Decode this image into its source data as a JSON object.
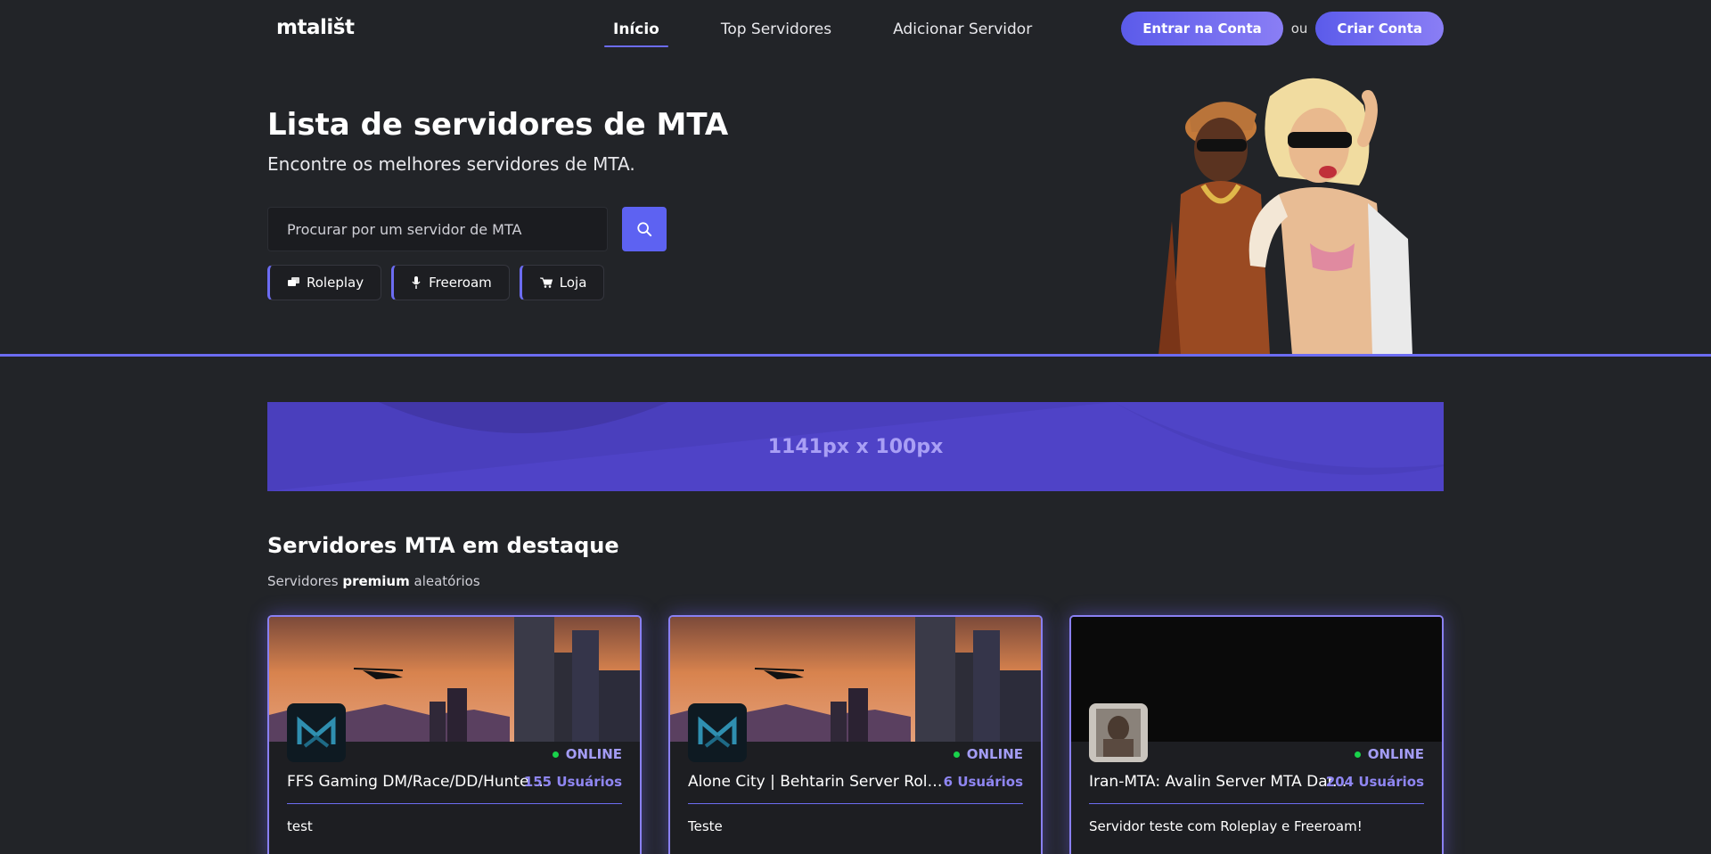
{
  "nav": {
    "logo": "mtališt",
    "links": [
      "Início",
      "Top Servidores",
      "Adicionar Servidor"
    ],
    "login": "Entrar na Conta",
    "or": "ou",
    "signup": "Criar Conta"
  },
  "hero": {
    "title": "Lista de servidores de MTA",
    "subtitle": "Encontre os melhores servidores de MTA.",
    "search_placeholder": "Procurar por um servidor de MTA",
    "tags": [
      {
        "label": "Roleplay",
        "icon": "chat-icon"
      },
      {
        "label": "Freeroam",
        "icon": "microphone-icon"
      },
      {
        "label": "Loja",
        "icon": "cart-icon"
      }
    ]
  },
  "banner": {
    "text": "1141px x 100px"
  },
  "featured": {
    "title": "Servidores MTA em destaque",
    "subtitle_pre": "Servidores",
    "subtitle_bold": "premium",
    "subtitle_post": "aleatórios",
    "cards": [
      {
        "name": "FFS Gaming DM/Race/DD/Hunte...",
        "status": "ONLINE",
        "users": "155 Usuários",
        "description": "test",
        "cover": "city-sunset",
        "avatar": "mta-logo"
      },
      {
        "name": "Alone City | Behtarin Server Role P...",
        "status": "ONLINE",
        "users": "6 Usuários",
        "description": "Teste",
        "cover": "city-sunset",
        "avatar": "mta-logo"
      },
      {
        "name": "Iran-MTA: Avalin Server MTA Dar...",
        "status": "ONLINE",
        "users": "204 Usuários",
        "description": "Servidor teste com Roleplay e Freeroam!",
        "cover": "dark",
        "avatar": "photo"
      }
    ]
  },
  "colors": {
    "accent": "#6c6cf2",
    "background": "#222428",
    "online": "#19d24b"
  }
}
